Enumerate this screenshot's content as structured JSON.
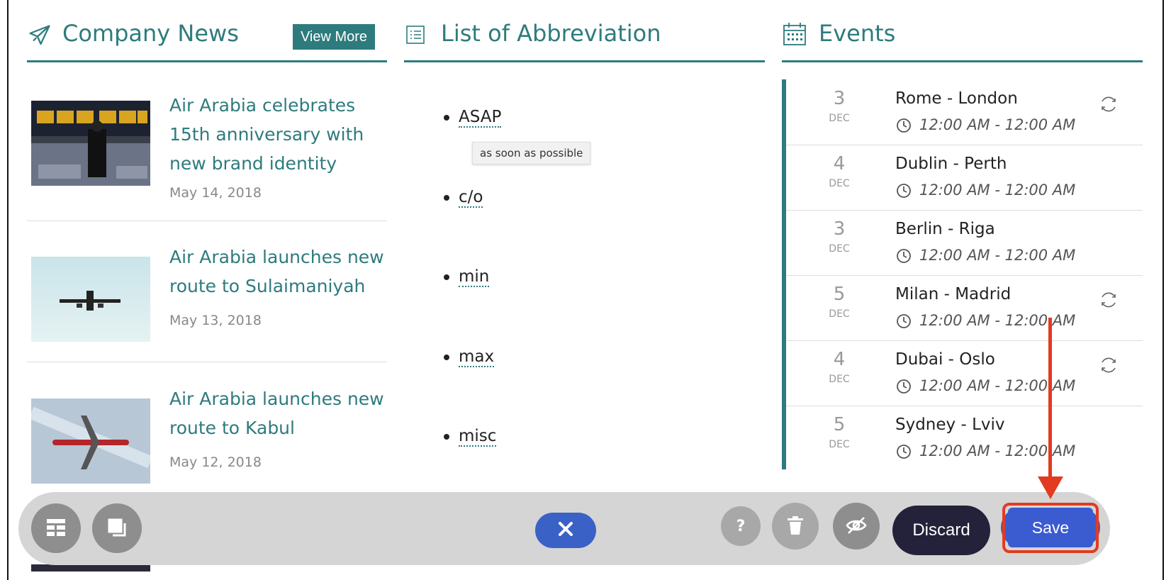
{
  "company_news": {
    "title": "Company News",
    "view_more": "View More",
    "items": [
      {
        "title": "Air Arabia celebrates 15th anniversary with new brand identity",
        "date": "May 14, 2018"
      },
      {
        "title": "Air Arabia launches new route to Sulaimaniyah",
        "date": "May 13, 2018"
      },
      {
        "title": "Air Arabia launches new route to Kabul",
        "date": "May 12, 2018"
      }
    ]
  },
  "abbreviations": {
    "title": "List of Abbreviation",
    "items": [
      "ASAP",
      "c/o",
      "min",
      "max",
      "misc"
    ],
    "tooltip": "as soon as possible"
  },
  "events": {
    "title": "Events",
    "items": [
      {
        "day": "3",
        "month": "DEC",
        "route": "Rome - London",
        "time": "12:00 AM - 12:00 AM",
        "recurring": true
      },
      {
        "day": "4",
        "month": "DEC",
        "route": "Dublin - Perth",
        "time": "12:00 AM - 12:00 AM",
        "recurring": false
      },
      {
        "day": "3",
        "month": "DEC",
        "route": "Berlin - Riga",
        "time": "12:00 AM - 12:00 AM",
        "recurring": false
      },
      {
        "day": "5",
        "month": "DEC",
        "route": "Milan - Madrid",
        "time": "12:00 AM - 12:00 AM",
        "recurring": true
      },
      {
        "day": "4",
        "month": "DEC",
        "route": "Dubai - Oslo",
        "time": "12:00 AM - 12:00 AM",
        "recurring": true
      },
      {
        "day": "5",
        "month": "DEC",
        "route": "Sydney - Lviv",
        "time": "12:00 AM - 12:00 AM",
        "recurring": false
      }
    ]
  },
  "toolbar": {
    "discard": "Discard",
    "save": "Save",
    "icons": [
      "layout-icon",
      "copy-icon",
      "close-icon",
      "help-icon",
      "delete-icon",
      "hide-icon"
    ]
  },
  "colors": {
    "teal": "#2e7b7d",
    "save_blue": "#3b5bd1",
    "discard_dark": "#23223a",
    "highlight_red": "#e23b20"
  }
}
